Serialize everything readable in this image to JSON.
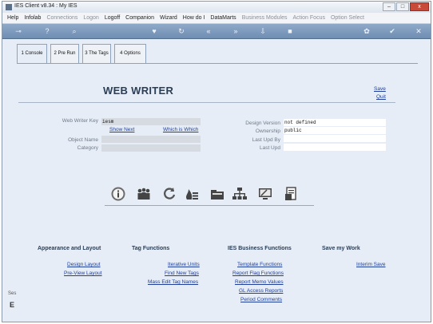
{
  "window": {
    "title": "IES Client v8.34 : My IES",
    "minimize": "–",
    "maximize": "□",
    "close": "x"
  },
  "menu": [
    "Help",
    "Infolab",
    "Connections",
    "Logon",
    "Logoff",
    "Companion",
    "Wizard",
    "How do I",
    "DataMarts",
    "Business Modules",
    "Action Focus",
    "Option Select"
  ],
  "menu_dim": [
    false,
    false,
    true,
    true,
    false,
    false,
    false,
    false,
    false,
    true,
    true,
    true
  ],
  "tabs": [
    "1 Console",
    "2 Pre Run",
    "3 The Tags",
    "4 Options"
  ],
  "header": {
    "title": "WEB WRITER",
    "save": "Save",
    "quit": "Quit"
  },
  "form": {
    "key_label": "Web Writer Key",
    "key_value": "iesm",
    "show_next": "Show Next",
    "which_is_which": "Which is Which",
    "object_name_label": "Object Name",
    "object_name_value": "",
    "category_label": "Category",
    "category_value": "",
    "design_version_label": "Design Version",
    "design_version_value": "not defined",
    "ownership_label": "Ownership",
    "ownership_value": "public",
    "last_upd_by_label": "Last Upd By",
    "last_upd_by_value": "",
    "last_upd_label": "Last Upd",
    "last_upd_value": ""
  },
  "functions": {
    "appearance": {
      "title": "Appearance and Layout",
      "links": [
        "Design Layout",
        "Pre-View Layout"
      ]
    },
    "tags": {
      "title": "Tag Functions",
      "links": [
        "Iterative Units",
        "Find New Tags",
        "Mass Edit Tag Names"
      ]
    },
    "business": {
      "title": "IES Business Functions",
      "links": [
        "Template Functions",
        "Report Flag Functions",
        "Report Memo Values",
        "GL Access Reports",
        "Period Comments"
      ]
    },
    "save": {
      "title": "Save my Work",
      "links": [
        "Interim Save"
      ]
    }
  },
  "side": {
    "text": "Ses",
    "glyph": "E"
  }
}
